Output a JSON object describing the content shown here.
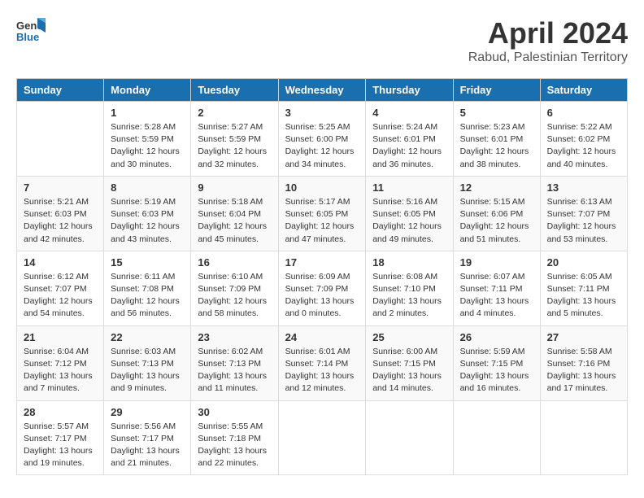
{
  "logo": {
    "line1": "General",
    "line2": "Blue"
  },
  "title": "April 2024",
  "subtitle": "Rabud, Palestinian Territory",
  "columns": [
    "Sunday",
    "Monday",
    "Tuesday",
    "Wednesday",
    "Thursday",
    "Friday",
    "Saturday"
  ],
  "weeks": [
    [
      {
        "day": "",
        "info": ""
      },
      {
        "day": "1",
        "info": "Sunrise: 5:28 AM\nSunset: 5:59 PM\nDaylight: 12 hours\nand 30 minutes."
      },
      {
        "day": "2",
        "info": "Sunrise: 5:27 AM\nSunset: 5:59 PM\nDaylight: 12 hours\nand 32 minutes."
      },
      {
        "day": "3",
        "info": "Sunrise: 5:25 AM\nSunset: 6:00 PM\nDaylight: 12 hours\nand 34 minutes."
      },
      {
        "day": "4",
        "info": "Sunrise: 5:24 AM\nSunset: 6:01 PM\nDaylight: 12 hours\nand 36 minutes."
      },
      {
        "day": "5",
        "info": "Sunrise: 5:23 AM\nSunset: 6:01 PM\nDaylight: 12 hours\nand 38 minutes."
      },
      {
        "day": "6",
        "info": "Sunrise: 5:22 AM\nSunset: 6:02 PM\nDaylight: 12 hours\nand 40 minutes."
      }
    ],
    [
      {
        "day": "7",
        "info": "Sunrise: 5:21 AM\nSunset: 6:03 PM\nDaylight: 12 hours\nand 42 minutes."
      },
      {
        "day": "8",
        "info": "Sunrise: 5:19 AM\nSunset: 6:03 PM\nDaylight: 12 hours\nand 43 minutes."
      },
      {
        "day": "9",
        "info": "Sunrise: 5:18 AM\nSunset: 6:04 PM\nDaylight: 12 hours\nand 45 minutes."
      },
      {
        "day": "10",
        "info": "Sunrise: 5:17 AM\nSunset: 6:05 PM\nDaylight: 12 hours\nand 47 minutes."
      },
      {
        "day": "11",
        "info": "Sunrise: 5:16 AM\nSunset: 6:05 PM\nDaylight: 12 hours\nand 49 minutes."
      },
      {
        "day": "12",
        "info": "Sunrise: 5:15 AM\nSunset: 6:06 PM\nDaylight: 12 hours\nand 51 minutes."
      },
      {
        "day": "13",
        "info": "Sunrise: 6:13 AM\nSunset: 7:07 PM\nDaylight: 12 hours\nand 53 minutes."
      }
    ],
    [
      {
        "day": "14",
        "info": "Sunrise: 6:12 AM\nSunset: 7:07 PM\nDaylight: 12 hours\nand 54 minutes."
      },
      {
        "day": "15",
        "info": "Sunrise: 6:11 AM\nSunset: 7:08 PM\nDaylight: 12 hours\nand 56 minutes."
      },
      {
        "day": "16",
        "info": "Sunrise: 6:10 AM\nSunset: 7:09 PM\nDaylight: 12 hours\nand 58 minutes."
      },
      {
        "day": "17",
        "info": "Sunrise: 6:09 AM\nSunset: 7:09 PM\nDaylight: 13 hours\nand 0 minutes."
      },
      {
        "day": "18",
        "info": "Sunrise: 6:08 AM\nSunset: 7:10 PM\nDaylight: 13 hours\nand 2 minutes."
      },
      {
        "day": "19",
        "info": "Sunrise: 6:07 AM\nSunset: 7:11 PM\nDaylight: 13 hours\nand 4 minutes."
      },
      {
        "day": "20",
        "info": "Sunrise: 6:05 AM\nSunset: 7:11 PM\nDaylight: 13 hours\nand 5 minutes."
      }
    ],
    [
      {
        "day": "21",
        "info": "Sunrise: 6:04 AM\nSunset: 7:12 PM\nDaylight: 13 hours\nand 7 minutes."
      },
      {
        "day": "22",
        "info": "Sunrise: 6:03 AM\nSunset: 7:13 PM\nDaylight: 13 hours\nand 9 minutes."
      },
      {
        "day": "23",
        "info": "Sunrise: 6:02 AM\nSunset: 7:13 PM\nDaylight: 13 hours\nand 11 minutes."
      },
      {
        "day": "24",
        "info": "Sunrise: 6:01 AM\nSunset: 7:14 PM\nDaylight: 13 hours\nand 12 minutes."
      },
      {
        "day": "25",
        "info": "Sunrise: 6:00 AM\nSunset: 7:15 PM\nDaylight: 13 hours\nand 14 minutes."
      },
      {
        "day": "26",
        "info": "Sunrise: 5:59 AM\nSunset: 7:15 PM\nDaylight: 13 hours\nand 16 minutes."
      },
      {
        "day": "27",
        "info": "Sunrise: 5:58 AM\nSunset: 7:16 PM\nDaylight: 13 hours\nand 17 minutes."
      }
    ],
    [
      {
        "day": "28",
        "info": "Sunrise: 5:57 AM\nSunset: 7:17 PM\nDaylight: 13 hours\nand 19 minutes."
      },
      {
        "day": "29",
        "info": "Sunrise: 5:56 AM\nSunset: 7:17 PM\nDaylight: 13 hours\nand 21 minutes."
      },
      {
        "day": "30",
        "info": "Sunrise: 5:55 AM\nSunset: 7:18 PM\nDaylight: 13 hours\nand 22 minutes."
      },
      {
        "day": "",
        "info": ""
      },
      {
        "day": "",
        "info": ""
      },
      {
        "day": "",
        "info": ""
      },
      {
        "day": "",
        "info": ""
      }
    ]
  ]
}
